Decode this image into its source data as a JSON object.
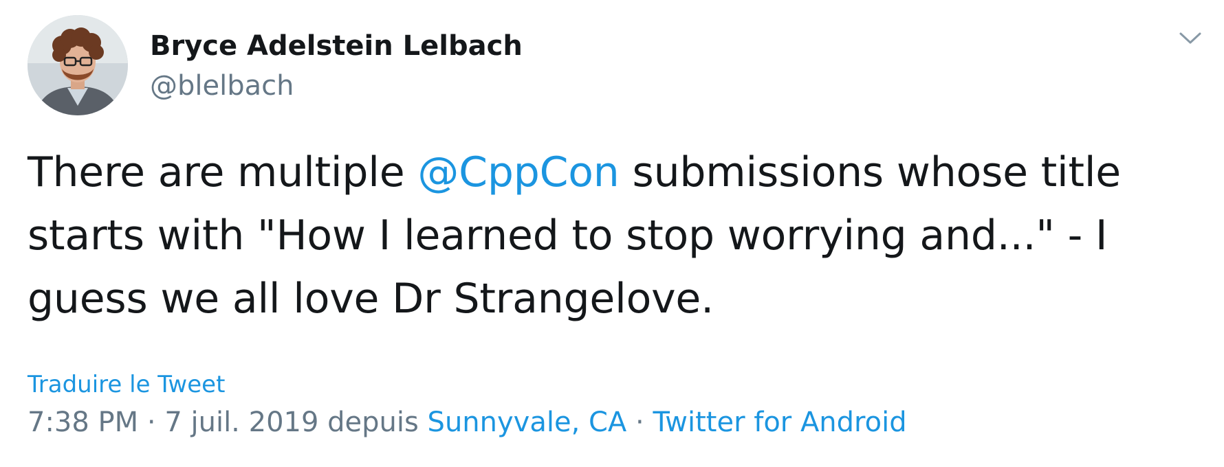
{
  "author": {
    "display_name": "Bryce Adelstein Lelbach",
    "handle": "@blelbach",
    "avatar_icon": "user-avatar"
  },
  "menu": {
    "icon": "chevron-down-icon"
  },
  "tweet": {
    "text_before": "There are multiple ",
    "mention": "@CppCon",
    "text_after": " submissions whose title starts with \"How I learned to stop worrying and...\" - I guess we all love Dr Strangelove."
  },
  "translate_label": "Traduire le Tweet",
  "meta": {
    "time": "7:38 PM",
    "separator1": " · ",
    "date": "7 juil. 2019",
    "from_label": " depuis ",
    "location": "Sunnyvale, CA",
    "separator2": " · ",
    "source": "Twitter for Android"
  },
  "colors": {
    "link": "#1b95e0",
    "text": "#14171a",
    "muted": "#657786"
  }
}
